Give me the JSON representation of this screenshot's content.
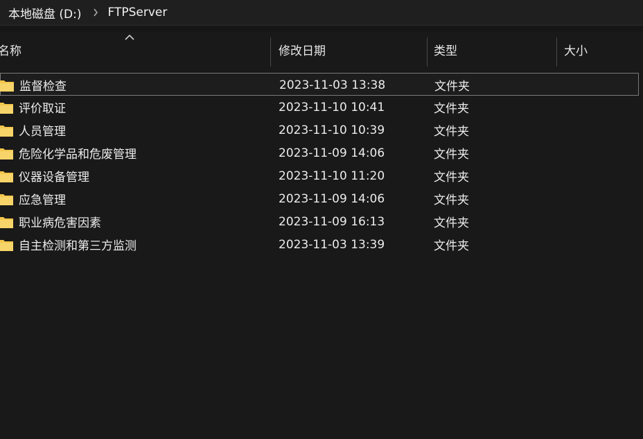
{
  "breadcrumb": {
    "root": "本地磁盘 (D:)",
    "separator_icon": "chevron-right-icon",
    "current": "FTPServer"
  },
  "columns": {
    "name": "名称",
    "date": "修改日期",
    "type": "类型",
    "size": "大小",
    "sort_icon": "sort-ascending-caret-icon"
  },
  "colors": {
    "background": "#191919",
    "folder": "#f4c64c",
    "selection_border": "#7a7a7a"
  },
  "files": [
    {
      "name": "监督检查",
      "date": "2023-11-03 13:38",
      "type": "文件夹",
      "icon": "folder-icon",
      "selected": true
    },
    {
      "name": "评价取证",
      "date": "2023-11-10 10:41",
      "type": "文件夹",
      "icon": "folder-icon"
    },
    {
      "name": "人员管理",
      "date": "2023-11-10 10:39",
      "type": "文件夹",
      "icon": "folder-icon"
    },
    {
      "name": "危险化学品和危废管理",
      "date": "2023-11-09 14:06",
      "type": "文件夹",
      "icon": "folder-icon"
    },
    {
      "name": "仪器设备管理",
      "date": "2023-11-10 11:20",
      "type": "文件夹",
      "icon": "folder-icon"
    },
    {
      "name": "应急管理",
      "date": "2023-11-09 14:06",
      "type": "文件夹",
      "icon": "folder-icon"
    },
    {
      "name": "职业病危害因素",
      "date": "2023-11-09 16:13",
      "type": "文件夹",
      "icon": "folder-icon"
    },
    {
      "name": "自主检测和第三方监测",
      "date": "2023-11-03 13:39",
      "type": "文件夹",
      "icon": "folder-icon"
    }
  ]
}
